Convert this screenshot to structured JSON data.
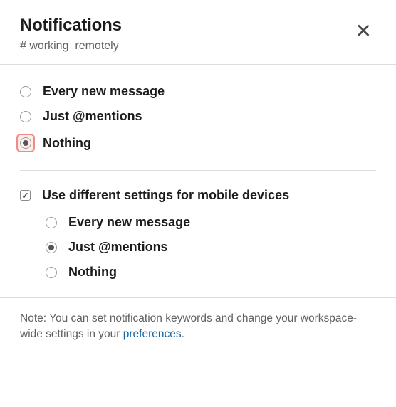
{
  "header": {
    "title": "Notifications",
    "channel_prefix": "# ",
    "channel_name": "working_remotely"
  },
  "desktop_options": [
    {
      "label": "Every new message",
      "selected": false
    },
    {
      "label": "Just @mentions",
      "selected": false
    },
    {
      "label": "Nothing",
      "selected": true,
      "highlighted": true
    }
  ],
  "mobile": {
    "checkbox_label": "Use different settings for mobile devices",
    "checked": true,
    "options": [
      {
        "label": "Every new message",
        "selected": false
      },
      {
        "label": "Just @mentions",
        "selected": true
      },
      {
        "label": "Nothing",
        "selected": false
      }
    ]
  },
  "footer": {
    "note_prefix": "Note: You can set notification keywords and change your workspace-wide settings in your ",
    "link_text": "preferences",
    "note_suffix": "."
  }
}
